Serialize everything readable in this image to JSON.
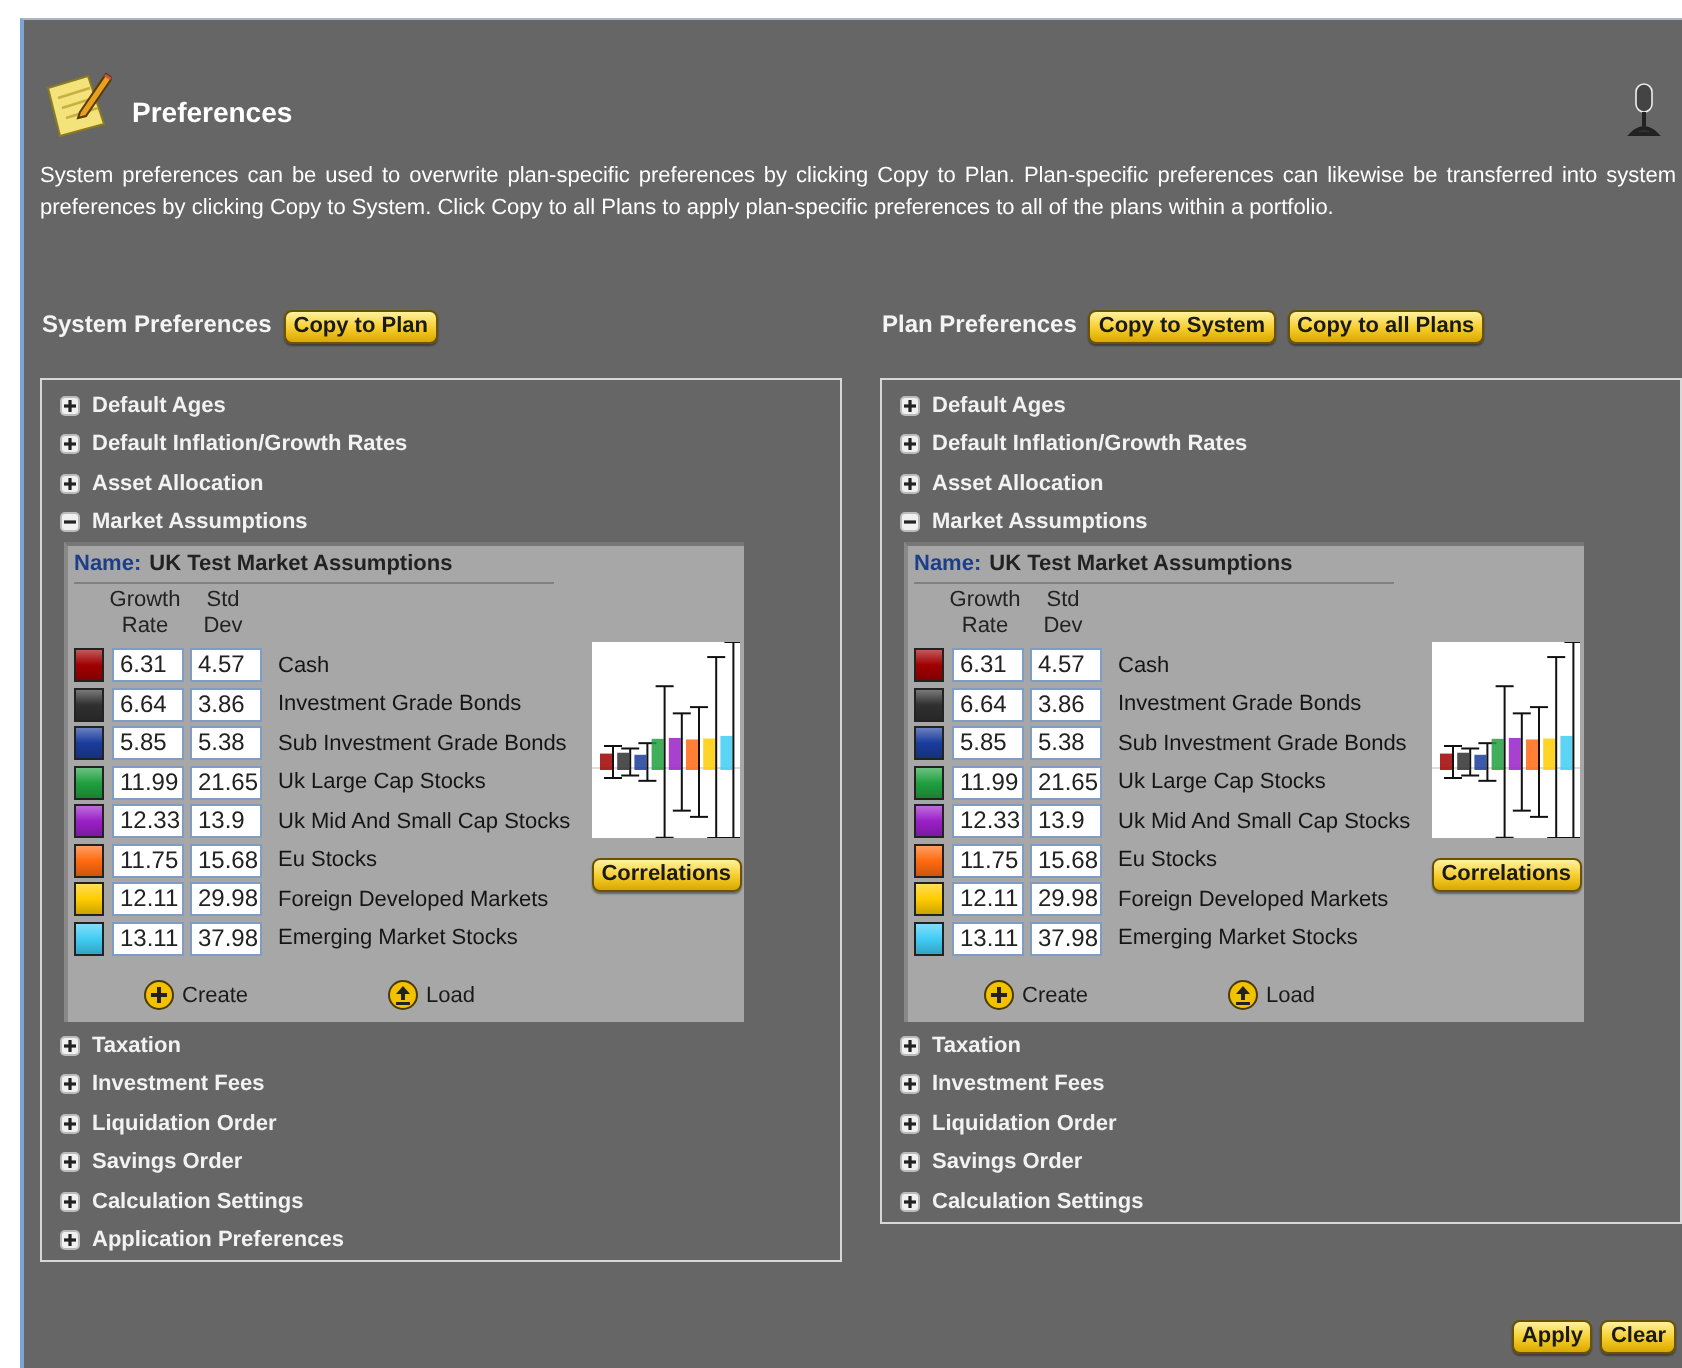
{
  "header": {
    "title": "Preferences",
    "description": "System preferences can be used to overwrite plan-specific preferences by clicking Copy to Plan. Plan-specific preferences can likewise be transferred into system preferences by clicking Copy to System. Click Copy to all Plans to apply plan-specific preferences to all of the plans within a portfolio."
  },
  "panels": [
    {
      "title": "System Preferences",
      "buttons": [
        "Copy to Plan"
      ],
      "sections": [
        {
          "label": "Default Ages",
          "expanded": false
        },
        {
          "label": "Default Inflation/Growth Rates",
          "expanded": false
        },
        {
          "label": "Asset Allocation",
          "expanded": false
        },
        {
          "label": "Market Assumptions",
          "expanded": true,
          "detail": {
            "name_label": "Name:",
            "name": "UK Test Market Assumptions",
            "columns": [
              "Growth Rate",
              "Std Dev"
            ],
            "assets": [
              {
                "color": "#a00000",
                "growth_rate": "6.31",
                "std_dev": "4.57",
                "name": "Cash"
              },
              {
                "color": "#303030",
                "growth_rate": "6.64",
                "std_dev": "3.86",
                "name": "Investment Grade Bonds"
              },
              {
                "color": "#1a3c9c",
                "growth_rate": "5.85",
                "std_dev": "5.38",
                "name": "Sub Investment Grade Bonds"
              },
              {
                "color": "#20a040",
                "growth_rate": "11.99",
                "std_dev": "21.65",
                "name": "Uk Large Cap Stocks"
              },
              {
                "color": "#9a20c8",
                "growth_rate": "12.33",
                "std_dev": "13.9",
                "name": "Uk Mid And Small Cap Stocks"
              },
              {
                "color": "#ff6a10",
                "growth_rate": "11.75",
                "std_dev": "15.68",
                "name": "Eu Stocks"
              },
              {
                "color": "#ffcc00",
                "growth_rate": "12.11",
                "std_dev": "29.98",
                "name": "Foreign Developed Markets"
              },
              {
                "color": "#40ccf4",
                "growth_rate": "13.11",
                "std_dev": "37.98",
                "name": "Emerging Market Stocks"
              }
            ],
            "correlations_button": "Correlations",
            "actions": [
              {
                "kind": "create",
                "label": "Create"
              },
              {
                "kind": "load",
                "label": "Load"
              }
            ]
          }
        },
        {
          "label": "Taxation",
          "expanded": false
        },
        {
          "label": "Investment Fees",
          "expanded": false
        },
        {
          "label": "Liquidation Order",
          "expanded": false
        },
        {
          "label": "Savings Order",
          "expanded": false
        },
        {
          "label": "Calculation Settings",
          "expanded": false
        },
        {
          "label": "Application Preferences",
          "expanded": false
        }
      ]
    },
    {
      "title": "Plan Preferences",
      "buttons": [
        "Copy to System",
        "Copy to all Plans"
      ],
      "sections": [
        {
          "label": "Default Ages",
          "expanded": false
        },
        {
          "label": "Default Inflation/Growth Rates",
          "expanded": false
        },
        {
          "label": "Asset Allocation",
          "expanded": false
        },
        {
          "label": "Market Assumptions",
          "expanded": true,
          "detail": {
            "name_label": "Name:",
            "name": "UK Test Market Assumptions",
            "columns": [
              "Growth Rate",
              "Std Dev"
            ],
            "assets": [
              {
                "color": "#a00000",
                "growth_rate": "6.31",
                "std_dev": "4.57",
                "name": "Cash"
              },
              {
                "color": "#303030",
                "growth_rate": "6.64",
                "std_dev": "3.86",
                "name": "Investment Grade Bonds"
              },
              {
                "color": "#1a3c9c",
                "growth_rate": "5.85",
                "std_dev": "5.38",
                "name": "Sub Investment Grade Bonds"
              },
              {
                "color": "#20a040",
                "growth_rate": "11.99",
                "std_dev": "21.65",
                "name": "Uk Large Cap Stocks"
              },
              {
                "color": "#9a20c8",
                "growth_rate": "12.33",
                "std_dev": "13.9",
                "name": "Uk Mid And Small Cap Stocks"
              },
              {
                "color": "#ff6a10",
                "growth_rate": "11.75",
                "std_dev": "15.68",
                "name": "Eu Stocks"
              },
              {
                "color": "#ffcc00",
                "growth_rate": "12.11",
                "std_dev": "29.98",
                "name": "Foreign Developed Markets"
              },
              {
                "color": "#40ccf4",
                "growth_rate": "13.11",
                "std_dev": "37.98",
                "name": "Emerging Market Stocks"
              }
            ],
            "correlations_button": "Correlations",
            "actions": [
              {
                "kind": "create",
                "label": "Create"
              },
              {
                "kind": "load",
                "label": "Load"
              }
            ]
          }
        },
        {
          "label": "Taxation",
          "expanded": false
        },
        {
          "label": "Investment Fees",
          "expanded": false
        },
        {
          "label": "Liquidation Order",
          "expanded": false
        },
        {
          "label": "Savings Order",
          "expanded": false
        },
        {
          "label": "Calculation Settings",
          "expanded": false
        }
      ]
    }
  ],
  "footer_buttons": [
    "Apply",
    "Clear"
  ]
}
